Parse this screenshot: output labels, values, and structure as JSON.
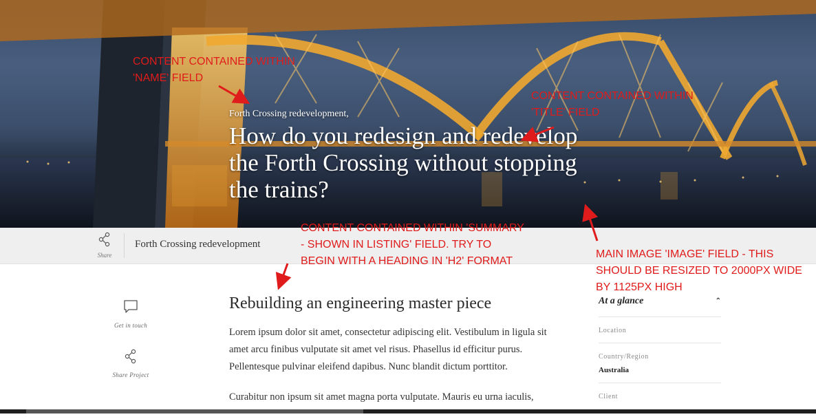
{
  "hero": {
    "name": "Forth Crossing redevelopment,",
    "title": "How do you redesign and redevelop the Forth Crossing without stopping the trains?"
  },
  "share_bar": {
    "share_label": "Share",
    "project_name": "Forth Crossing redevelopment"
  },
  "actions": {
    "get_in_touch": "Get in touch",
    "share_project": "Share Project"
  },
  "content": {
    "heading": "Rebuilding an engineering master piece",
    "paragraphs": [
      "Lorem ipsum dolor sit amet, consectetur adipiscing elit. Vestibulum in ligula sit amet arcu finibus vulputate sit amet vel risus. Phasellus id efficitur purus. Pellentesque pulvinar eleifend dapibus. Nunc blandit dictum porttitor.",
      "Curabitur non ipsum sit amet magna porta vulputate. Mauris eu urna iaculis,"
    ]
  },
  "sidebar": {
    "title": "At a glance",
    "rows": [
      {
        "label": "Location",
        "value": ""
      },
      {
        "label": "Country/Region",
        "value": "Australia"
      },
      {
        "label": "Client",
        "value": ""
      }
    ]
  },
  "annotations": {
    "name_field": "CONTENT CONTAINED WITHIN 'NAME' FIELD",
    "title_field": "CONTENT CONTAINED WITHIN 'TITLE' FIELD",
    "summary_field": "CONTENT CONTAINED WITHIN 'SUMMARY - SHOWN IN LISTING' FIELD. TRY TO BEGIN WITH A HEADING IN 'H2' FORMAT",
    "image_field": "MAIN IMAGE 'IMAGE' FIELD - THIS SHOULD BE RESIZED TO 2000PX WIDE BY 1125PX HIGH"
  },
  "colors": {
    "annotation": "#e01b1b",
    "bridge_lights": "#f0a830",
    "sky": "#4b6182"
  },
  "icons": [
    "share-icon",
    "chat-bubble-icon",
    "chevron-up-icon"
  ]
}
